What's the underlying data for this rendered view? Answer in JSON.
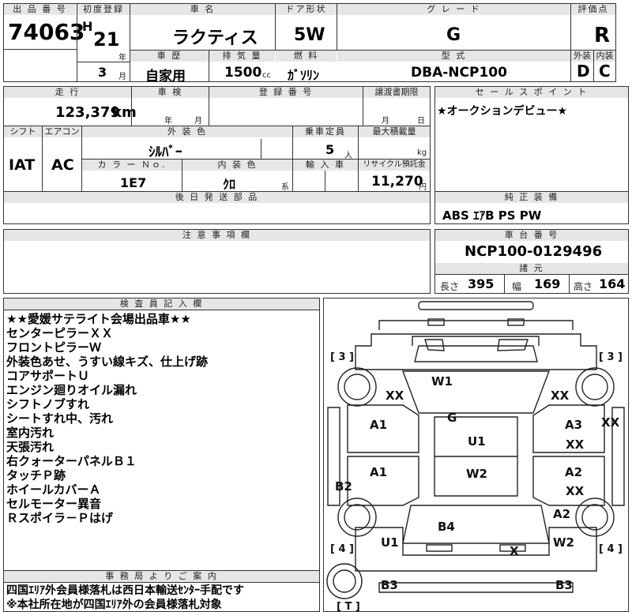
{
  "header": {
    "lot_no_label": "出 品 番 号",
    "lot_no": "74063",
    "first_reg_label": "初度登録",
    "era": "H",
    "year": "21",
    "year_unit": "年",
    "month": "3",
    "month_unit": "月",
    "car_name_label": "車 名",
    "car_name": "ラクティス",
    "door_label": "ドア形状",
    "door": "5W",
    "grade_label": "グ レ ー ド",
    "grade": "G",
    "score_label": "評価点",
    "score": "R",
    "history_label": "車 歴",
    "history": "自家用",
    "displacement_label": "排 気 量",
    "displacement": "1500",
    "displacement_unit": "cc",
    "fuel_label": "燃 料",
    "fuel": "ｶﾞｿﾘﾝ",
    "model_label": "型 式",
    "model": "DBA-NCP100",
    "exterior_label": "外装",
    "exterior": "D",
    "interior_label": "内装",
    "interior": "C"
  },
  "info": {
    "mileage_label": "走 行",
    "mileage": "123,379",
    "mileage_unit": "km",
    "inspection_label": "車 検",
    "inspection_year": "年",
    "inspection_month": "月",
    "regno_label": "登 録 番 号",
    "transfer_label": "譲渡書期限",
    "transfer_month": "月",
    "transfer_day": "日",
    "shift_label": "シフト",
    "shift": "IAT",
    "ac_label": "エアコン",
    "ac": "AC",
    "color_label": "外 装 色",
    "color": "ｼﾙﾊﾞｰ",
    "capacity_label": "乗車定員",
    "capacity": "5",
    "capacity_unit": "人",
    "maxload_label": "最大積載量",
    "maxload_unit": "kg",
    "colorno_label": "カ ラ ー Ｎｏ.",
    "colorno": "1E7",
    "intcolor_label": "内 装 色",
    "intcolor": "ｸﾛ",
    "intcolor_unit": "系",
    "import_label": "輸 入 車",
    "recycle_label": "リサイクル預託金",
    "recycle": "11,270",
    "recycle_unit": "円",
    "later_parts_label": "後 日 発 送 部 品",
    "notes_label": "注 意 事 項 欄"
  },
  "sales": {
    "label": "セ ー ル ス ポ イ ン ト",
    "text": "★オークションデビュー★",
    "equip_label": "純 正 装 備",
    "equip": "ABS ｴｱB PS PW",
    "chassis_label": "車 台 番 号",
    "chassis": "NCP100-0129496",
    "dims_label": "諸 元",
    "length_label": "長さ",
    "length": "395",
    "width_label": "幅",
    "width": "169",
    "height_label": "高さ",
    "height": "164"
  },
  "inspector": {
    "label": "検 査 員 記 入 欄",
    "lines": [
      "★★愛媛サテライト会場出品車★★",
      "センターピラーＸＸ",
      "フロントピラーＷ",
      "外装色あせ、うすい線キズ、仕上げ跡",
      "コアサポートＵ",
      "エンジン廻りオイル漏れ",
      "シフトノブすれ",
      "シートすれ中、汚れ",
      "室内汚れ",
      "天張汚れ",
      "右クォーターパネルＢ１",
      "タッチＰ跡",
      "ホイールカバーＡ",
      "セルモーター異音",
      "Ｒスポイラ－Ｐはげ"
    ]
  },
  "office": {
    "label": "事 務 局 よ り ご 案 内",
    "lines": [
      "四国ｴﾘｱ外会員様落札は西日本輸送ｾﾝﾀｰ手配です",
      "※本社所在地が四国ｴﾘｱ外の会員様落札対象"
    ]
  },
  "diagram": {
    "tire_fl": "[ 3 ]",
    "tire_fr": "[ 3 ]",
    "tire_rl": "[ 4 ]",
    "tire_rr": "[ 4 ]",
    "tire_spare": "[ T ]",
    "marks": {
      "w1": "W1",
      "xx_fl": "XX",
      "xx_fr": "XX",
      "g": "G",
      "xx_r": "XX",
      "a1_fl": "A1",
      "a3": "A3",
      "xx_rf": "XX",
      "u1_top": "U1",
      "a1_rl": "A1",
      "w2_c": "W2",
      "a2": "A2",
      "xx_rr": "XX",
      "b2": "B2",
      "a2_rq": "A2",
      "b4": "B4",
      "u1_rear": "U1",
      "w2_r": "W2",
      "x": "X",
      "b3_l": "B3",
      "b3_r": "B3"
    }
  }
}
